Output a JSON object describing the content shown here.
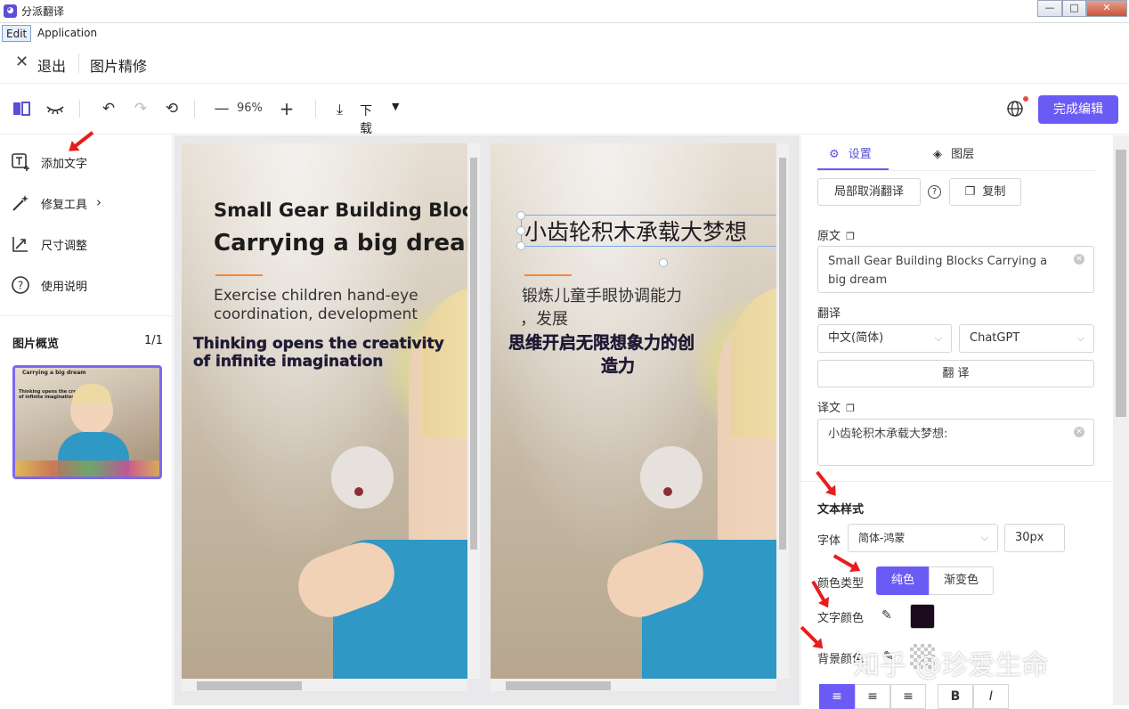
{
  "window": {
    "title": "分派翻译",
    "min": "—",
    "max": "□",
    "close": "✕"
  },
  "menubar": {
    "edit": "Edit",
    "application": "Application"
  },
  "header": {
    "exit_label": "退出",
    "page_title": "图片精修"
  },
  "toolbar": {
    "zoom": "96%",
    "download_label": "下载",
    "finish_label": "完成编辑"
  },
  "left_tools": [
    {
      "label": "添加文字",
      "icon": "add-text-icon"
    },
    {
      "label": "修复工具",
      "icon": "magic-wand-icon"
    },
    {
      "label": "尺寸调整",
      "icon": "resize-icon"
    },
    {
      "label": "使用说明",
      "icon": "help-icon"
    }
  ],
  "overview": {
    "title": "图片概览",
    "count": "1/1",
    "thumb_text": [
      "Carrying a big dream",
      "Thinking opens the creativity",
      "of infinite imagination"
    ]
  },
  "original_image": {
    "title1": "Small Gear Building Blocks",
    "title2": "Carrying a big dream",
    "sub1": "Exercise children hand-eye",
    "sub2": "coordination, development",
    "bold1": "Thinking opens the creativity",
    "bold2": "of infinite imagination"
  },
  "translated_image": {
    "title": "小齿轮积木承载大梦想",
    "sub1": "锻炼儿童手眼协调能力",
    "sub2": "，发展",
    "bold1": "思维开启无限想象力的创",
    "bold2": "造力"
  },
  "settings": {
    "tab_settings": "设置",
    "tab_layers": "图层",
    "cancel_partial": "局部取消翻译",
    "copy": "复制",
    "source_label": "原文",
    "source_text": "Small Gear Building Blocks Carrying a big dream",
    "translate_label": "翻译",
    "language": "中文(简体)",
    "engine": "ChatGPT",
    "translate_btn": "翻 译",
    "result_label": "译文",
    "result_text": "小齿轮积木承载大梦想:",
    "text_style_title": "文本样式",
    "font_label": "字体",
    "font_value": "简体-鸿蒙",
    "font_size": "30px",
    "color_type_label": "颜色类型",
    "color_solid": "纯色",
    "color_gradient": "渐变色",
    "text_color_label": "文字颜色",
    "text_color": "#1c0b1e",
    "bg_color_label": "背景颜色"
  },
  "format_buttons": [
    "≡",
    "≡",
    "≡",
    "B",
    "I"
  ],
  "accent_color": "#6b5bf5",
  "watermark": "知乎 @珍爱生命"
}
